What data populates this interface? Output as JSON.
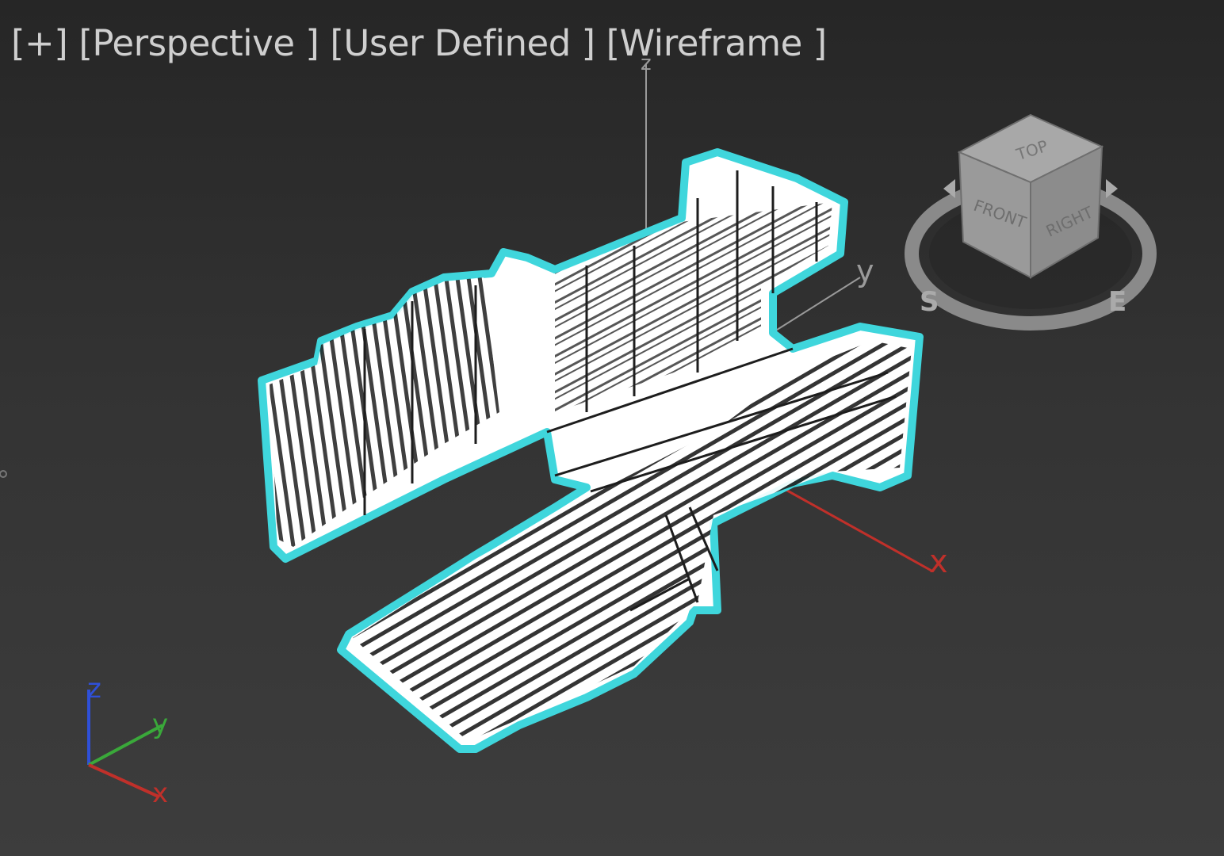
{
  "viewport": {
    "labels": [
      "[+]",
      "[Perspective ]",
      "[User Defined ]",
      "[Wireframe ]"
    ],
    "render_mode": "Wireframe",
    "view": "Perspective",
    "shading": "User Defined"
  },
  "gizmo": {
    "x_label": "x",
    "y_label": "y",
    "z_label": "z"
  },
  "world_axes": {
    "x_label": "x",
    "y_label": "y",
    "z_label": "z"
  },
  "viewcube": {
    "faces": [
      "TOP",
      "FRONT",
      "RIGHT"
    ],
    "compass": [
      "S",
      "E"
    ]
  },
  "colors": {
    "background_top": "#262626",
    "background_bottom": "#3d3d3d",
    "label_text": "#cfcfcf",
    "wireframe": "#ffffff",
    "selection_outline": "#3fd6dc",
    "axis_x": "#c0302a",
    "axis_y": "#3aa83a",
    "axis_z": "#2f50d8",
    "gizmo_line": "#9a9a9a"
  }
}
